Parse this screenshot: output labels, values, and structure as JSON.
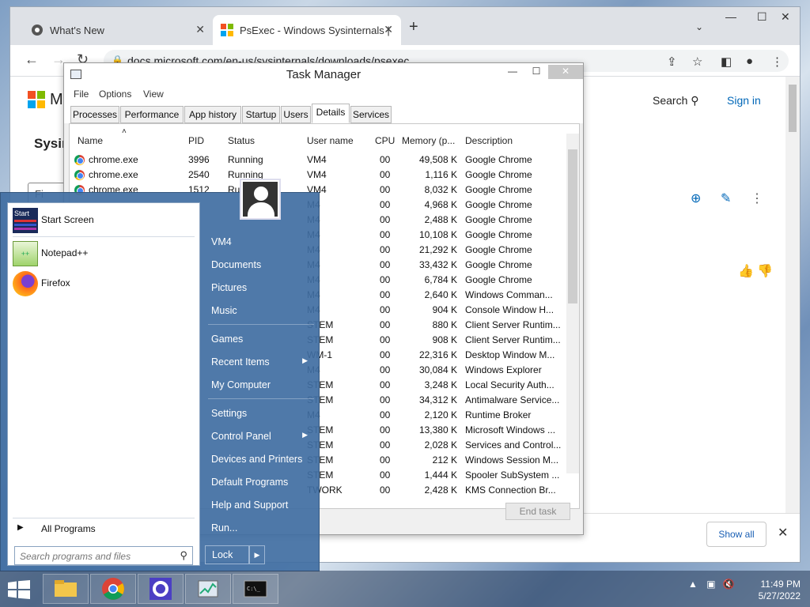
{
  "browser": {
    "tabs": [
      {
        "title": "What's New"
      },
      {
        "title": "PsExec - Windows Sysinternals | "
      }
    ],
    "url": "docs.microsoft.com/en-us/sysinternals/downloads/psexec"
  },
  "page": {
    "logo_text": "M",
    "search_label": "Search",
    "signin_label": "Sign in",
    "heading": "Sysin",
    "filter_label": "Fi",
    "show_all_label": "Show all"
  },
  "task_manager": {
    "title": "Task Manager",
    "menu": [
      "File",
      "Options",
      "View"
    ],
    "tabs": [
      "Processes",
      "Performance",
      "App history",
      "Startup",
      "Users",
      "Details",
      "Services"
    ],
    "active_tab": "Details",
    "columns": [
      "Name",
      "PID",
      "Status",
      "User name",
      "CPU",
      "Memory (p...",
      "Description"
    ],
    "rows": [
      {
        "name": "chrome.exe",
        "pid": "3996",
        "status": "Running",
        "user": "VM4",
        "cpu": "00",
        "mem": "49,508 K",
        "desc": "Google Chrome"
      },
      {
        "name": "chrome.exe",
        "pid": "2540",
        "status": "Running",
        "user": "VM4",
        "cpu": "00",
        "mem": "1,116 K",
        "desc": "Google Chrome"
      },
      {
        "name": "chrome.exe",
        "pid": "1512",
        "status": "Ru",
        "user": "VM4",
        "cpu": "00",
        "mem": "8,032 K",
        "desc": "Google Chrome"
      },
      {
        "name": "",
        "pid": "",
        "status": "",
        "user": "M4",
        "cpu": "00",
        "mem": "4,968 K",
        "desc": "Google Chrome"
      },
      {
        "name": "",
        "pid": "",
        "status": "",
        "user": "M4",
        "cpu": "00",
        "mem": "2,488 K",
        "desc": "Google Chrome"
      },
      {
        "name": "",
        "pid": "",
        "status": "",
        "user": "M4",
        "cpu": "00",
        "mem": "10,108 K",
        "desc": "Google Chrome"
      },
      {
        "name": "",
        "pid": "",
        "status": "",
        "user": "M4",
        "cpu": "00",
        "mem": "21,292 K",
        "desc": "Google Chrome"
      },
      {
        "name": "",
        "pid": "",
        "status": "",
        "user": "M4",
        "cpu": "00",
        "mem": "33,432 K",
        "desc": "Google Chrome"
      },
      {
        "name": "",
        "pid": "",
        "status": "",
        "user": "M4",
        "cpu": "00",
        "mem": "6,784 K",
        "desc": "Google Chrome"
      },
      {
        "name": "",
        "pid": "",
        "status": "",
        "user": "M4",
        "cpu": "00",
        "mem": "2,640 K",
        "desc": "Windows Comman..."
      },
      {
        "name": "",
        "pid": "",
        "status": "",
        "user": "M4",
        "cpu": "00",
        "mem": "904 K",
        "desc": "Console Window H..."
      },
      {
        "name": "",
        "pid": "",
        "status": "",
        "user": "STEM",
        "cpu": "00",
        "mem": "880 K",
        "desc": "Client Server Runtim..."
      },
      {
        "name": "",
        "pid": "",
        "status": "",
        "user": "STEM",
        "cpu": "00",
        "mem": "908 K",
        "desc": "Client Server Runtim..."
      },
      {
        "name": "",
        "pid": "",
        "status": "",
        "user": "WM-1",
        "cpu": "00",
        "mem": "22,316 K",
        "desc": "Desktop Window M..."
      },
      {
        "name": "",
        "pid": "",
        "status": "",
        "user": "M4",
        "cpu": "00",
        "mem": "30,084 K",
        "desc": "Windows Explorer"
      },
      {
        "name": "",
        "pid": "",
        "status": "",
        "user": "STEM",
        "cpu": "00",
        "mem": "3,248 K",
        "desc": "Local Security Auth..."
      },
      {
        "name": "",
        "pid": "",
        "status": "",
        "user": "STEM",
        "cpu": "00",
        "mem": "34,312 K",
        "desc": "Antimalware Service..."
      },
      {
        "name": "",
        "pid": "",
        "status": "",
        "user": "M4",
        "cpu": "00",
        "mem": "2,120 K",
        "desc": "Runtime Broker"
      },
      {
        "name": "",
        "pid": "",
        "status": "",
        "user": "STEM",
        "cpu": "00",
        "mem": "13,380 K",
        "desc": "Microsoft Windows ..."
      },
      {
        "name": "",
        "pid": "",
        "status": "",
        "user": "STEM",
        "cpu": "00",
        "mem": "2,028 K",
        "desc": "Services and Control..."
      },
      {
        "name": "",
        "pid": "",
        "status": "",
        "user": "STEM",
        "cpu": "00",
        "mem": "212 K",
        "desc": "Windows Session M..."
      },
      {
        "name": "",
        "pid": "",
        "status": "",
        "user": "STEM",
        "cpu": "00",
        "mem": "1,444 K",
        "desc": "Spooler SubSystem ..."
      },
      {
        "name": "",
        "pid": "",
        "status": "",
        "user": "TWORK",
        "cpu": "00",
        "mem": "2,428 K",
        "desc": "KMS Connection Br..."
      }
    ],
    "end_task_label": "End task"
  },
  "start_menu": {
    "pinned": [
      {
        "label": "Start Screen",
        "icon": "start-screen-icon"
      },
      {
        "label": "Notepad++",
        "icon": "notepad-plus-plus-icon"
      },
      {
        "label": "Firefox",
        "icon": "firefox-icon"
      }
    ],
    "all_programs_label": "All Programs",
    "search_placeholder": "Search programs and files",
    "right_links": [
      "VM4",
      "Documents",
      "Pictures",
      "Music",
      "Games",
      "Recent Items",
      "My Computer",
      "Settings",
      "Control Panel",
      "Devices and Printers",
      "Default Programs",
      "Help and Support",
      "Run..."
    ],
    "lock_label": "Lock",
    "start_tile_text": "Start"
  },
  "taskbar": {
    "time": "11:49 PM",
    "date": "5/27/2022",
    "apps": [
      "file-explorer-icon",
      "chrome-icon",
      "settings-icon",
      "task-manager-icon",
      "command-prompt-icon"
    ]
  }
}
